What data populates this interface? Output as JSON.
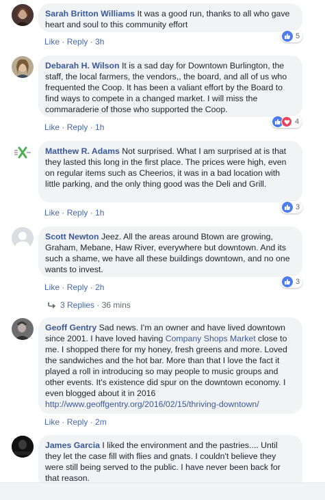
{
  "comments": [
    {
      "author": "Sarah Britton Williams",
      "text": "It was a good run, thanks to all who gave heart and soul to this community effort",
      "actions": {
        "like": "Like",
        "reply": "Reply",
        "time": "3h"
      },
      "reaction_count": "5",
      "reactions": [
        "like"
      ]
    },
    {
      "author": "Debarah H. Wilson",
      "text": "It is a sad day for Downtown Burlington, the staff, the local farmers, the vendors,, the board, and all of us who frequented the Coop. It has been a valiant effort by the Board to find ways to compete in a changed market. I will miss the commaraderie of those who supported the Coop.",
      "actions": {
        "like": "Like",
        "reply": "Reply",
        "time": "1h"
      },
      "reaction_count": "4",
      "reactions": [
        "like",
        "love"
      ]
    },
    {
      "author": "Matthew R. Adams",
      "text": "Not surprised. What I am surprised at is that they lasted this long in the first place. The prices were high, even on regular items such as Cheerios, it was in a bad location with little parking, and the only thing good was the Deli and Grill.",
      "actions": {
        "like": "Like",
        "reply": "Reply",
        "time": "1h"
      },
      "reaction_count": "3",
      "reactions": [
        "like"
      ]
    },
    {
      "author": "Scott Newton",
      "text": "Jeez. All the areas around Btown are growing, Graham, Mebane, Haw River, everywhere but downtown. And its such a shame, we have all these buildings downtown, and no one wants to invest.",
      "actions": {
        "like": "Like",
        "reply": "Reply",
        "time": "2h"
      },
      "reaction_count": "3",
      "reactions": [
        "like"
      ],
      "replies_label": "3 Replies",
      "replies_time": "36 mins"
    },
    {
      "author": "Geoff Gentry",
      "text_before": "Sad news. I'm an owner and have lived downtown since 2001. I have loved having ",
      "text_link": "Company Shops Market",
      "text_after": " close to me. I shopped there for my honey, fresh greens and more. Loved the sandwiches and the hot bar. More than that I love the fact it played a roll in introducing so may people to music groups and other events. It's existence did spur on the downtown economy. I even blogged about it in 2016 ",
      "url": "http://www.geoffgentry.org/2016/02/15/thriving-downtown/",
      "actions": {
        "like": "Like",
        "reply": "Reply",
        "time": "2m"
      }
    },
    {
      "author": "James Garcia",
      "text": "I liked the environment and the pastries.... Until they let the case fill with flies and gnats. I couldn't believe they were still being served to the public. I have never been back for that reason."
    }
  ],
  "colors": {
    "link": "#385898",
    "bubble": "#f2f3f5",
    "like": "#4c7cf0",
    "love": "#f0415b"
  }
}
